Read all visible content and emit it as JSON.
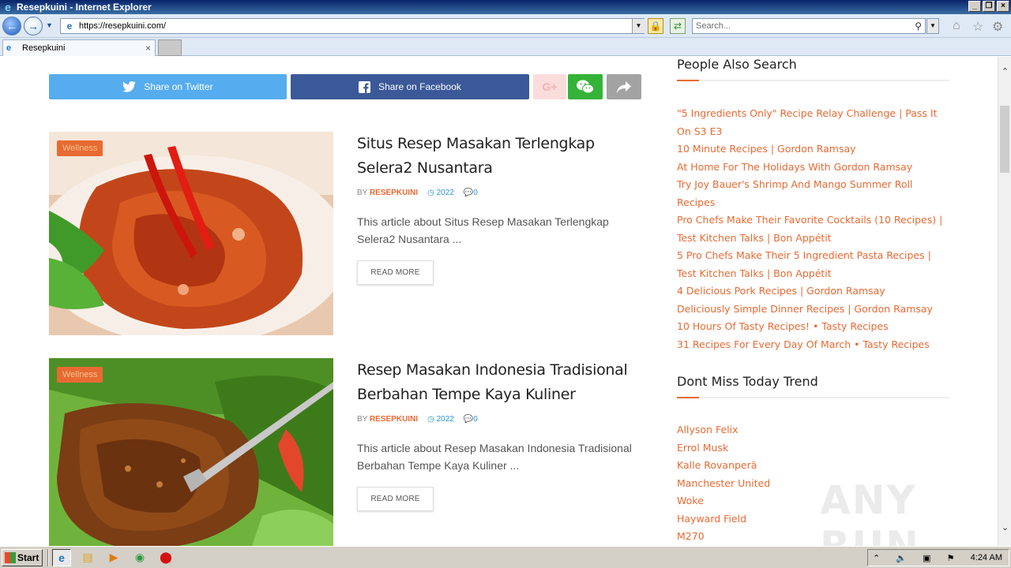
{
  "window": {
    "title": "Resepkuini - Internet Explorer",
    "url": "https://resepkuini.com/",
    "search_placeholder": "Search...",
    "tab_label": "Resepkuini"
  },
  "share": {
    "twitter": "Share on Twitter",
    "facebook": "Share on Facebook",
    "gplus": "G+"
  },
  "articles": [
    {
      "category": "Wellness",
      "title": "Situs Resep Masakan Terlengkap Selera2 Nusantara",
      "by": "BY",
      "author": "RESEPKUINI",
      "year": "2022",
      "comments": "0",
      "excerpt": "This article about Situs Resep Masakan Terlengkap Selera2 Nusantara ...",
      "read_more": "READ MORE"
    },
    {
      "category": "Wellness",
      "title": "Resep Masakan Indonesia Tradisional Berbahan Tempe Kaya Kuliner",
      "by": "BY",
      "author": "RESEPKUINI",
      "year": "2022",
      "comments": "0",
      "excerpt": "This article about Resep Masakan Indonesia Tradisional Berbahan Tempe Kaya Kuliner ...",
      "read_more": "READ MORE"
    }
  ],
  "sidebar": {
    "people_also_search": {
      "heading": "People Also Search",
      "items": [
        "\"5 Ingredients Only\" Recipe Relay Challenge | Pass It On S3 E3",
        "10 Minute Recipes | Gordon Ramsay",
        "At Home For The Holidays With Gordon Ramsay",
        "Try Joy Bauer's Shrimp And Mango Summer Roll Recipes",
        "Pro Chefs Make Their Favorite Cocktails (10 Recipes) | Test Kitchen Talks | Bon Appétit",
        "5 Pro Chefs Make Their 5 Ingredient Pasta Recipes | Test Kitchen Talks | Bon Appétit",
        "4 Delicious Pork Recipes | Gordon Ramsay",
        "Deliciously Simple Dinner Recipes | Gordon Ramsay",
        "10 Hours Of Tasty Recipes! • Tasty Recipes",
        "31 Recipes For Every Day Of March • Tasty Recipes"
      ]
    },
    "dont_miss": {
      "heading": "Dont Miss Today Trend",
      "items": [
        "Allyson Felix",
        "Errol Musk",
        "Kalle Rovanperä",
        "Manchester United",
        "Woke",
        "Hayward Field",
        "M270"
      ]
    }
  },
  "watermark": "ANY RUN",
  "taskbar": {
    "start_label": "Start",
    "clock": "4:24 AM"
  },
  "colors": {
    "accent": "#e86a33",
    "twitter": "#55acee",
    "facebook": "#3b5998",
    "wechat": "#35b338"
  }
}
